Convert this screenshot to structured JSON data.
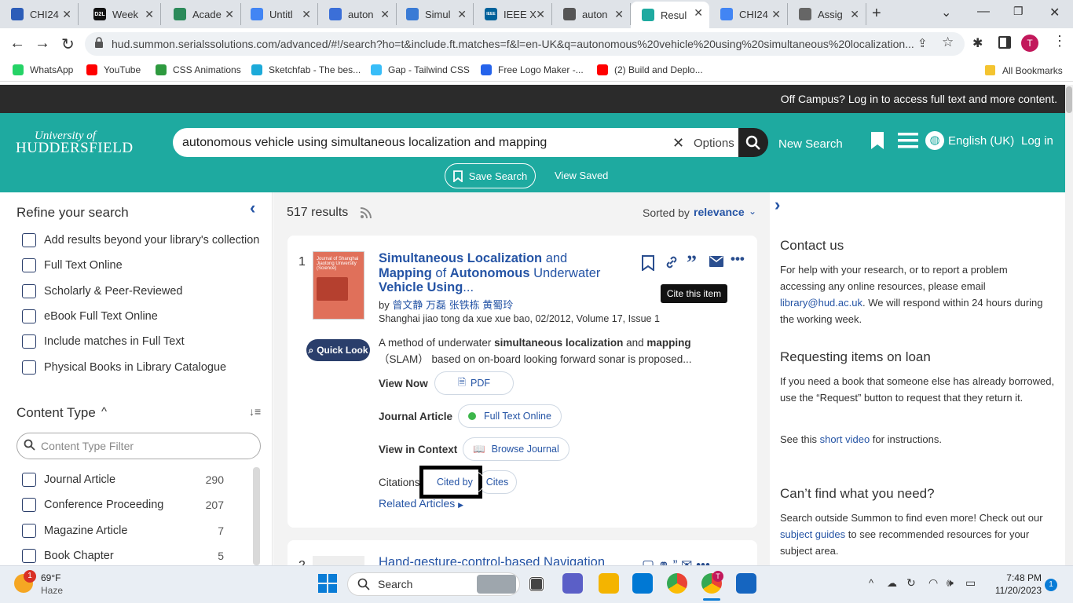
{
  "browser": {
    "tabs": [
      {
        "title": "CHI24",
        "color": "#2c5db8"
      },
      {
        "title": "Week",
        "color": "#111111"
      },
      {
        "title": "Acade",
        "color": "#2b8a5a"
      },
      {
        "title": "Untitl",
        "color": "#4285f4"
      },
      {
        "title": "auton",
        "color": "#3b6fd8"
      },
      {
        "title": "Simul",
        "color": "#3a7bd5"
      },
      {
        "title": "IEEE X",
        "color": "#00629b"
      },
      {
        "title": "auton",
        "color": "#555555"
      },
      {
        "title": "Resul",
        "color": "#1eaaa0"
      },
      {
        "title": "CHI24",
        "color": "#4285f4"
      },
      {
        "title": "Assig",
        "color": "#666666"
      }
    ],
    "d2l_fav": "D2L",
    "ieee_fav": "IEEE",
    "url": "hud.summon.serialssolutions.com/advanced/#!/search?ho=t&include.ft.matches=f&l=en-UK&q=autonomous%20vehicle%20using%20simultaneous%20localization...",
    "profile_initial": "T",
    "bookmarks": [
      {
        "label": "WhatsApp",
        "color": "#25d366"
      },
      {
        "label": "YouTube",
        "color": "#ff0000"
      },
      {
        "label": "CSS Animations",
        "color": "#2e9a3f"
      },
      {
        "label": "Sketchfab - The bes...",
        "color": "#1caad9"
      },
      {
        "label": "Gap - Tailwind CSS",
        "color": "#38bdf8"
      },
      {
        "label": "Free Logo Maker -...",
        "color": "#2563eb"
      },
      {
        "label": "(2) Build and Deplo...",
        "color": "#ff0000"
      }
    ],
    "all_bookmarks": "All Bookmarks"
  },
  "page": {
    "offcampus": "Off Campus? Log in to access full text and more content.",
    "logo_line1": "University of",
    "logo_line2": "HUDDERSFIELD",
    "search_value": "autonomous vehicle using simultaneous localization and mapping",
    "options": "Options",
    "new_search": "New Search",
    "language": "English (UK)",
    "login": "Log in",
    "save_search": "Save Search",
    "view_saved": "View Saved"
  },
  "refine": {
    "title": "Refine your search",
    "options": [
      "Add results beyond your library's collection",
      "Full Text Online",
      "Scholarly & Peer-Reviewed",
      "eBook Full Text Online",
      "Include matches in Full Text",
      "Physical Books in Library Catalogue"
    ],
    "content_type_title": "Content Type",
    "filter_placeholder": "Content Type Filter",
    "content_types": [
      {
        "label": "Journal Article",
        "count": "290"
      },
      {
        "label": "Conference Proceeding",
        "count": "207"
      },
      {
        "label": "Magazine Article",
        "count": "7"
      },
      {
        "label": "Book Chapter",
        "count": "5"
      }
    ]
  },
  "results": {
    "count": "517 results",
    "sorted_by": "Sorted by",
    "sort_value": "relevance",
    "item1": {
      "number": "1",
      "title_1": "Simultaneous Localization",
      "title_2": " and",
      "title_3": "Mapping",
      "title_4": " of ",
      "title_5": "Autonomous",
      "title_6": " Underwater",
      "title_7": "Vehicle Using",
      "title_8": "...",
      "by": "by",
      "authors": "曾文静 万磊 张铁栋 黄蜀玲",
      "source": "Shanghai jiao tong da xue xue bao, 02/2012, Volume 17, Issue 1",
      "abstract_1": "A method of underwater ",
      "abstract_2": "simultaneous localization",
      "abstract_3": " and ",
      "abstract_4": "mapping",
      "abstract_5": "（SLAM） based on on-board looking forward sonar is proposed...",
      "quick_look": "Quick Look",
      "view_now": "View Now",
      "pdf": "PDF",
      "type": "Journal Article",
      "full_text": "Full Text Online",
      "view_in_context": "View in Context",
      "browse_journal": "Browse Journal",
      "citations": "Citations",
      "cited_by": "Cited by",
      "cites": "Cites",
      "related": "Related Articles",
      "tooltip": "Cite this item",
      "cover_text": "Journal of Shanghai Jiaotong University (Science)"
    },
    "item2": {
      "number": "2",
      "title": "Hand-gesture-control-based Navigation"
    }
  },
  "sidebar_right": {
    "contact_title": "Contact us",
    "contact_text_1": "For help with your research, or to report a problem accessing any online resources, please email ",
    "contact_email": "library@hud.ac.uk",
    "contact_text_2": ". We will respond within 24 hours during the working week.",
    "loan_title": "Requesting items on loan",
    "loan_text": "If you need a book that someone else has already borrowed, use the “Request” button to request that they return it.",
    "video_text_1": "See this ",
    "video_link": "short video",
    "video_text_2": " for instructions.",
    "cant_find_title": "Can’t find what you need?",
    "cant_find_text_1": "Search outside Summon to find even more! Check out our ",
    "cant_find_link": "subject guides",
    "cant_find_text_2": " to see recommended resources for your subject area."
  },
  "taskbar": {
    "weather_temp": "69°F",
    "weather_desc": "Haze",
    "weather_badge": "1",
    "search": "Search",
    "time": "7:48 PM",
    "date": "11/20/2023",
    "notification_count": "1",
    "chrome_profile": "T"
  }
}
